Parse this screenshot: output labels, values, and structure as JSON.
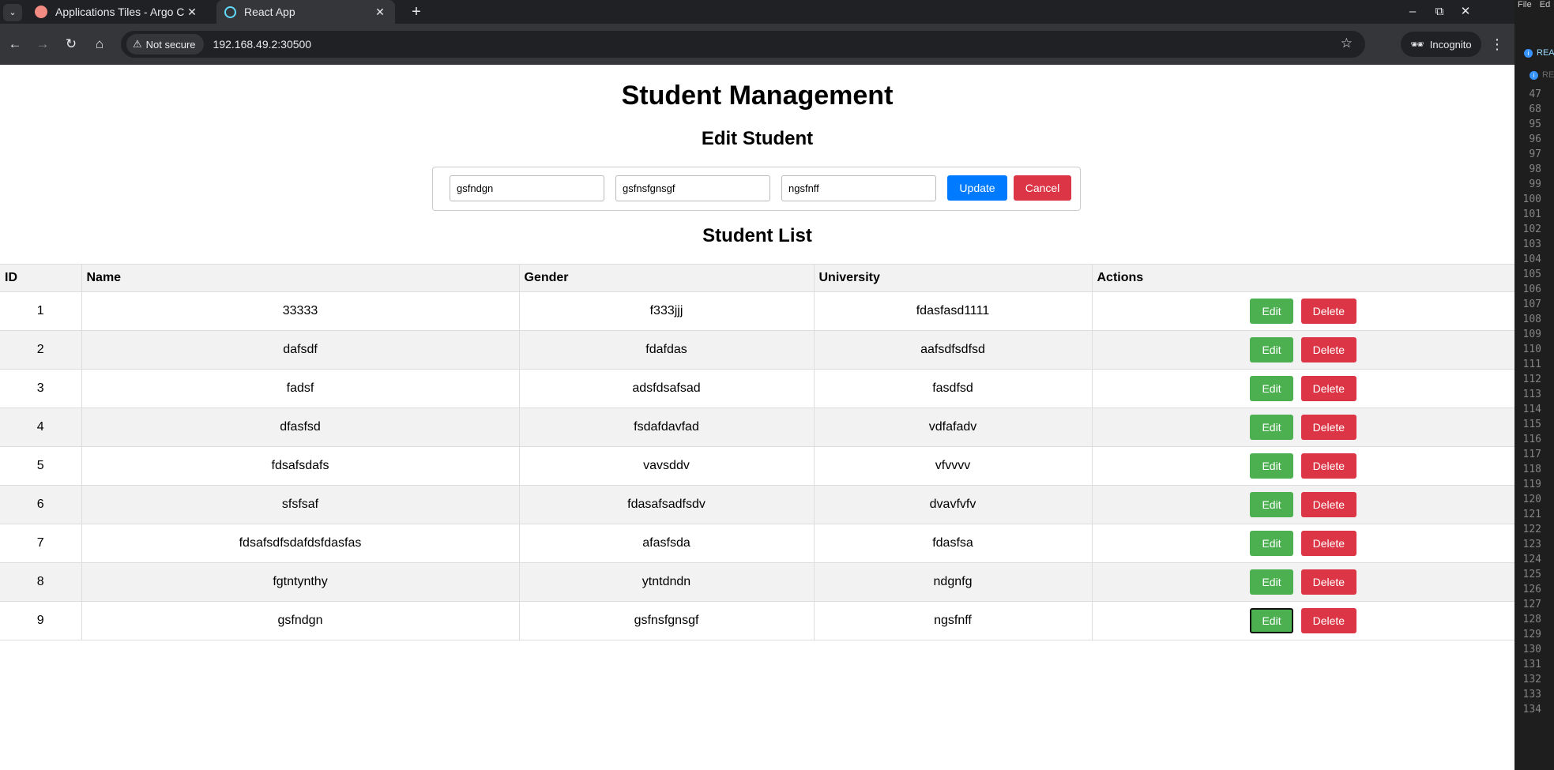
{
  "browser": {
    "tab_list_icon": "chevron-down-icon",
    "tabs": [
      {
        "title": "Applications Tiles - Argo CD",
        "favicon": "argo-icon",
        "active": false
      },
      {
        "title": "React App",
        "favicon": "react-icon",
        "active": true
      }
    ],
    "new_tab": "+",
    "window_controls": {
      "minimize": "–",
      "restore": "⧉",
      "close": "✕"
    },
    "toolbar": {
      "back": "←",
      "forward": "→",
      "reload": "↻",
      "home": "⌂",
      "security_label": "Not secure",
      "url": "192.168.49.2:30500",
      "incognito_label": "Incognito",
      "menu": "⋮"
    }
  },
  "app": {
    "title": "Student Management",
    "edit_heading": "Edit Student",
    "form": {
      "name_value": "gsfndgn",
      "gender_value": "gsfnsfgnsgf",
      "university_value": "ngsfnff",
      "update_label": "Update",
      "cancel_label": "Cancel"
    },
    "list_heading": "Student List",
    "table": {
      "headers": [
        "ID",
        "Name",
        "Gender",
        "University",
        "Actions"
      ],
      "edit_label": "Edit",
      "delete_label": "Delete",
      "rows": [
        {
          "id": "1",
          "name": "33333",
          "gender": "f333jjj",
          "university": "fdasfasd1111"
        },
        {
          "id": "2",
          "name": "dafsdf",
          "gender": "fdafdas",
          "university": "aafsdfsdfsd"
        },
        {
          "id": "3",
          "name": "fadsf",
          "gender": "adsfdsafsad",
          "university": "fasdfsd"
        },
        {
          "id": "4",
          "name": "dfasfsd",
          "gender": "fsdafdavfad",
          "university": "vdfafadv"
        },
        {
          "id": "5",
          "name": "fdsafsdafs",
          "gender": "vavsddv",
          "university": "vfvvvv"
        },
        {
          "id": "6",
          "name": "sfsfsaf",
          "gender": "fdasafsadfsdv",
          "university": "dvavfvfv"
        },
        {
          "id": "7",
          "name": "fdsafsdfsdafdsfdasfas",
          "gender": "afasfsda",
          "university": "fdasfsa"
        },
        {
          "id": "8",
          "name": "fgtntynthy",
          "gender": "ytntdndn",
          "university": "ndgnfg"
        },
        {
          "id": "9",
          "name": "gsfndgn",
          "gender": "gsfnsfgnsgf",
          "university": "ngsfnff"
        }
      ]
    }
  },
  "side_editor": {
    "menu": [
      "File",
      "Ed"
    ],
    "info_lines": [
      "REA",
      "RE"
    ],
    "line_numbers": [
      "47",
      "68",
      "95",
      "96",
      "97",
      "98",
      "99",
      "100",
      "101",
      "102",
      "103",
      "104",
      "105",
      "106",
      "107",
      "108",
      "109",
      "110",
      "111",
      "112",
      "113",
      "114",
      "115",
      "116",
      "117",
      "118",
      "119",
      "120",
      "121",
      "122",
      "123",
      "124",
      "125",
      "126",
      "127",
      "128",
      "129",
      "130",
      "131",
      "132",
      "133",
      "134"
    ]
  }
}
